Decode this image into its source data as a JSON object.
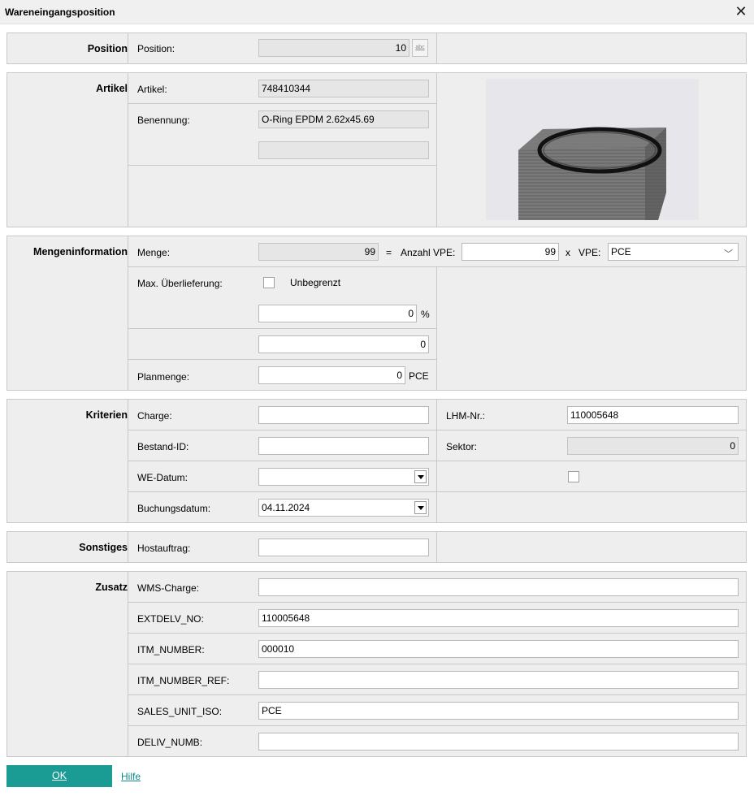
{
  "window": {
    "title": "Wareneingangsposition",
    "close_icon": "close-icon"
  },
  "position": {
    "section_label": "Position",
    "position_label": "Position:",
    "position_value": "10",
    "abc_button": "abc"
  },
  "artikel": {
    "section_label": "Artikel",
    "artikel_label": "Artikel:",
    "artikel_value": "748410344",
    "benennung_label": "Benennung:",
    "benennung_value": "O-Ring EPDM 2.62x45.69",
    "benennung2_value": ""
  },
  "menge": {
    "section_label": "Mengeninformation",
    "menge_label": "Menge:",
    "menge_value": "99",
    "eq": "=",
    "anzahl_label": "Anzahl VPE:",
    "anzahl_value": "99",
    "x": "x",
    "vpe_label": "VPE:",
    "vpe_value": "PCE",
    "max_label": "Max. Überlieferung:",
    "unbegrenzt_label": "Unbegrenzt",
    "percent_value": "0",
    "percent_unit": "%",
    "abs_value": "0",
    "plan_label": "Planmenge:",
    "plan_value": "0",
    "plan_unit": "PCE"
  },
  "kriterien": {
    "section_label": "Kriterien",
    "charge_label": "Charge:",
    "charge_value": "",
    "lhm_label": "LHM-Nr.:",
    "lhm_value": "110005648",
    "bestand_label": "Bestand-ID:",
    "bestand_value": "",
    "sektor_label": "Sektor:",
    "sektor_value": "0",
    "wedatum_label": "WE-Datum:",
    "wedatum_value": "",
    "buchung_label": "Buchungsdatum:",
    "buchung_value": "04.11.2024"
  },
  "sonstiges": {
    "section_label": "Sonstiges",
    "host_label": "Hostauftrag:",
    "host_value": ""
  },
  "zusatz": {
    "section_label": "Zusatz",
    "rows": [
      {
        "label": "WMS-Charge:",
        "value": ""
      },
      {
        "label": "EXTDELV_NO:",
        "value": "110005648"
      },
      {
        "label": "ITM_NUMBER:",
        "value": "000010"
      },
      {
        "label": "ITM_NUMBER_REF:",
        "value": ""
      },
      {
        "label": "SALES_UNIT_ISO:",
        "value": "PCE"
      },
      {
        "label": "DELIV_NUMB:",
        "value": ""
      }
    ]
  },
  "footer": {
    "ok_label": "OK",
    "hilfe_label": "Hilfe"
  },
  "colors": {
    "accent": "#1a9b93",
    "section_bg": "#eeeeee",
    "border": "#c8c8c8"
  }
}
